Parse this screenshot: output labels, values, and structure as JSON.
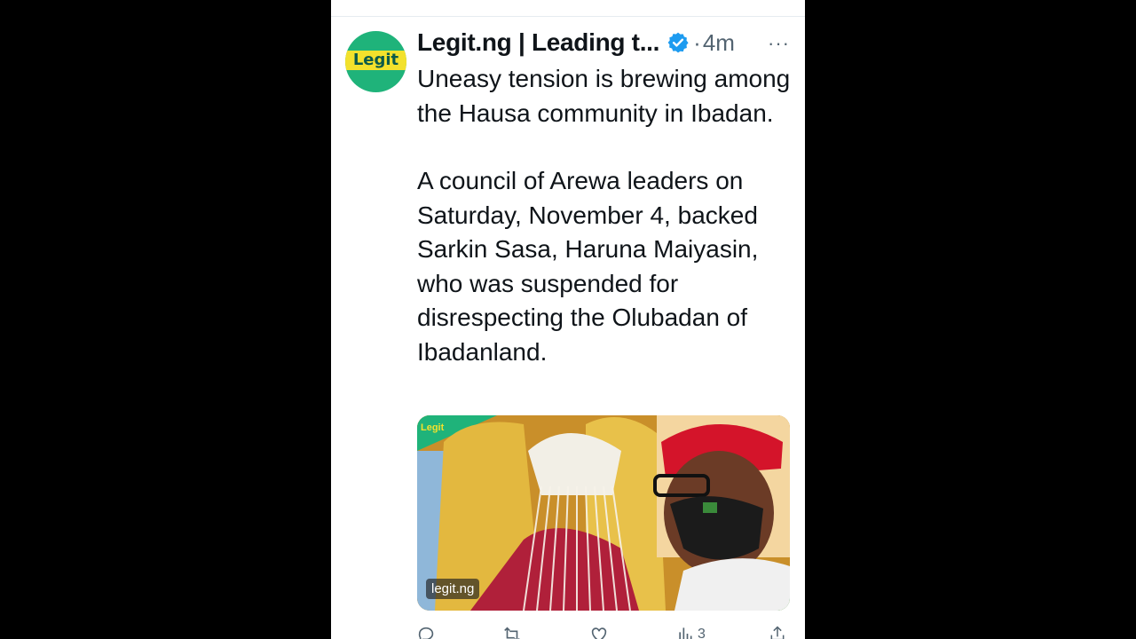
{
  "tweet": {
    "author": "Legit.ng | Leading t...",
    "time_separator": "·",
    "time": "4m",
    "more_label": "···",
    "avatar_label": "Legit",
    "paragraphs": [
      "Uneasy tension is brewing among the Hausa community in Ibadan.",
      "A council of Arewa leaders on Saturday, November 4, backed Sarkin Sasa, Haruna Maiyasin, who was suspended for disrespecting the Olubadan of Ibadanland."
    ],
    "media": {
      "watermark": "legit.ng",
      "corner_logo": "Legit"
    },
    "actions": {
      "views_count": "3"
    }
  },
  "colors": {
    "brand_green": "#1fb37a",
    "brand_yellow": "#f3e12c",
    "verified_blue": "#1d9bf0",
    "text": "#0f1419",
    "muted": "#536471"
  }
}
